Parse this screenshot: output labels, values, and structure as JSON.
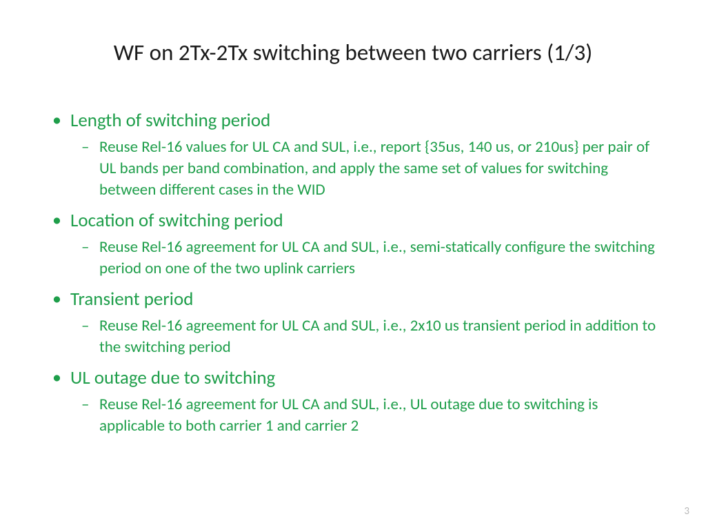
{
  "title": "WF on 2Tx-2Tx switching between two carriers (1/3)",
  "bullets": [
    {
      "label": "Length of switching period",
      "sub": [
        "Reuse Rel-16 values for UL CA and SUL, i.e., report {35us, 140 us, or 210us} per pair of UL bands per band combination, and apply the same set of values for switching between different cases in the WID"
      ]
    },
    {
      "label": "Location of switching period",
      "sub": [
        "Reuse Rel-16 agreement for UL CA and SUL, i.e., semi-statically configure the switching period on one of the two uplink carriers"
      ]
    },
    {
      "label": "Transient period",
      "sub": [
        "Reuse Rel-16 agreement for UL CA and SUL, i.e., 2x10 us transient period in addition to the switching period"
      ]
    },
    {
      "label": "UL outage due to switching",
      "sub": [
        "Reuse Rel-16 agreement for UL CA and SUL, i.e., UL outage due to switching is applicable to both carrier 1 and carrier 2"
      ]
    }
  ],
  "pagenum": "3"
}
